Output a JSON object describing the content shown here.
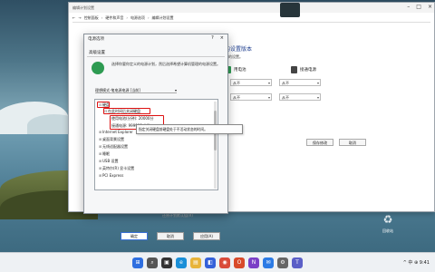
{
  "main_window": {
    "title": "编辑计划设置",
    "breadcrumbs": [
      "控制面板",
      "硬件和声音",
      "电源选项",
      "编辑计划设置"
    ],
    "heading": "的设置版本",
    "subtext": "用的设置。",
    "columns": [
      {
        "label": "用电池",
        "icon": "battery-icon"
      },
      {
        "label": "接通电源",
        "icon": "plug-icon"
      }
    ],
    "select_value": "从不",
    "save_button": "保存修改",
    "cancel_button": "取消"
  },
  "dialog": {
    "title": "电源选项",
    "help_glyph": "?",
    "close_glyph": "×",
    "tab": "高级设置",
    "description": "选择你要你定义的电源计划，然后选择希望计算机管理的电源设置。",
    "plan": "理想模式-笔电源电源 [当前]",
    "tree_items": [
      {
        "label": "硬盘",
        "expanded": true,
        "level": 0
      },
      {
        "label": "在此时间后关闭硬盘",
        "expanded": true,
        "level": 1
      },
      {
        "label": "使用电池(分钟): 20000分",
        "level": 2
      },
      {
        "label": "接通电源: 999999 分钟",
        "level": 2
      },
      {
        "label": "Internet Explorer",
        "level": 0
      },
      {
        "label": "桌面背景设置",
        "level": 0
      },
      {
        "label": "无线适配器设置",
        "level": 0
      },
      {
        "label": "睡眠",
        "level": 0
      },
      {
        "label": "USB 设置",
        "level": 0
      },
      {
        "label": "英特尔(R) 显卡设置",
        "level": 0
      },
      {
        "label": "PCI Express",
        "level": 0
      }
    ],
    "tooltip": "指定关闭硬盘前硬盘处于不活动状态的时间。",
    "restore_button": "还原计划默认值(R)",
    "ok_button": "确定",
    "cancel_button": "取消",
    "apply_button": "应用(A)"
  },
  "desktop": {
    "recycle_bin_label": "回收站"
  },
  "taskbar": {
    "icons": [
      "start-icon",
      "search-icon",
      "taskview-icon",
      "edge-icon",
      "explorer-icon",
      "store-icon",
      "chrome-icon",
      "office-icon",
      "onenote-icon",
      "mail-icon",
      "settings-icon",
      "teams-icon"
    ],
    "tray_text": "^ 中 ⊕ 9:41"
  },
  "colors": {
    "accent": "#3a6fd8",
    "highlight": "#dd1111",
    "heading": "#1f3f8f"
  }
}
